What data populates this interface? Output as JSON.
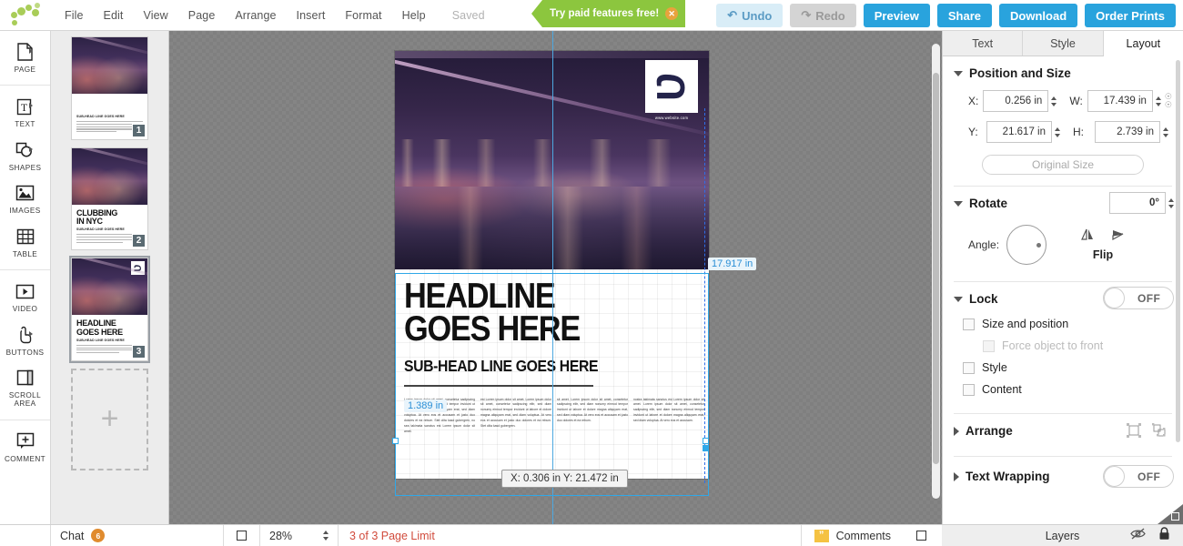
{
  "app": {
    "menu": [
      "File",
      "Edit",
      "View",
      "Page",
      "Arrange",
      "Insert",
      "Format",
      "Help"
    ],
    "saved_label": "Saved"
  },
  "promo": {
    "text": "Try paid features free!",
    "close": "✕"
  },
  "toolbar": {
    "undo": "Undo",
    "undo_icon": "↶",
    "redo": "Redo",
    "redo_icon": "↷",
    "preview": "Preview",
    "share": "Share",
    "download": "Download",
    "order_prints": "Order Prints",
    "accent": "#29a3dd"
  },
  "rail": {
    "groups": [
      {
        "items": [
          {
            "label": "PAGE",
            "icon": "page-icon",
            "arrow": true
          }
        ]
      },
      {
        "items": [
          {
            "label": "TEXT",
            "icon": "text-icon",
            "arrow": true
          },
          {
            "label": "SHAPES",
            "icon": "shapes-icon",
            "arrow": true
          },
          {
            "label": "IMAGES",
            "icon": "images-icon",
            "arrow": false
          },
          {
            "label": "TABLE",
            "icon": "table-icon",
            "arrow": false
          }
        ]
      },
      {
        "items": [
          {
            "label": "VIDEO",
            "icon": "video-icon",
            "arrow": false
          },
          {
            "label": "BUTTONS",
            "icon": "buttons-icon",
            "arrow": true
          },
          {
            "label": "SCROLL AREA",
            "icon": "scroll-area-icon",
            "arrow": false
          }
        ]
      },
      {
        "items": [
          {
            "label": "COMMENT",
            "icon": "comment-icon",
            "arrow": false
          }
        ]
      }
    ]
  },
  "pages": {
    "thumbnails": [
      {
        "number": "1",
        "headline": "",
        "subhead": "SUB-HEAD LINE GOES HERE",
        "has_logo": false
      },
      {
        "number": "2",
        "headline": "CLUBBING\nIN NYC",
        "subhead": "SUB-HEAD LINE GOES HERE",
        "has_logo": false
      },
      {
        "number": "3",
        "headline": "HEADLINE\nGOES HERE",
        "subhead": "SUB-HEAD LINE GOES HERE",
        "has_logo": true
      }
    ],
    "add_label": "+"
  },
  "document": {
    "headline_line1": "HEADLINE",
    "headline_line2": "GOES HERE",
    "subhead": "SUB-HEAD LINE GOES HERE",
    "logo_letter": "Ʋ",
    "logo_url": "www.website.com",
    "body_columns": [
      "Lorem ipsum dolor sit amet, consetetur sadipscing elitr, sed diam nonumy eirmod tempor invidunt ut labore et dolore magna aliquyam erat, sed diam voluptua. At vero eos et accusam et justo duo dolores et ea rebum. Stet clita kasd gubergren, no sea takimata sanctus est Lorem ipsum dolor sit amet.",
      "est Lorem ipsum dolor sit amet. Lorem ipsum dolor sit amet, consetetur sadipscing elitr, sed diam nonumy eirmod tempor invidunt ut labore et dolore magna aliquyam erat, sed diam voluptua. At vero eos et accusam et justo duo dolores et ea rebum. Stet clita kasd gubergren.",
      "sit amet. Lorem ipsum dolor sit amet, consetetur sadipscing elitr, sed diam nonumy eirmod tempor invidunt ut labore et dolore magna aliquyam erat, sed diam voluptua. At vero eos et accusam et justo duo dolores et ea rebum.",
      "nostra takimata sanctus est Lorem ipsum dolor sit amet. Lorem ipsum dolor sit amet, consetetur sadipscing elitr, sed diam nonumy eirmod tempor invidunt ut labore et dolore magna aliquyam erat, sed diam voluptua. At vero eos et accusam."
    ]
  },
  "canvas": {
    "width_label": "17.917 in",
    "height_label": "1.389 in",
    "coord_tooltip": "X: 0.306 in   Y: 21.472 in",
    "guide_color": "#4ea8e0"
  },
  "panel": {
    "tabs": [
      {
        "label": "Text",
        "active": false
      },
      {
        "label": "Style",
        "active": false
      },
      {
        "label": "Layout",
        "active": true
      }
    ],
    "position_and_size": {
      "title": "Position and Size",
      "x_label": "X:",
      "x_value": "0.256 in",
      "y_label": "Y:",
      "y_value": "21.617 in",
      "w_label": "W:",
      "w_value": "17.439 in",
      "h_label": "H:",
      "h_value": "2.739 in",
      "original_size": "Original Size"
    },
    "rotate": {
      "title": "Rotate",
      "angle_value": "0°",
      "angle_label": "Angle:",
      "flip_label": "Flip"
    },
    "lock": {
      "title": "Lock",
      "toggle_state": "OFF",
      "items": [
        {
          "label": "Size and position",
          "checked": false,
          "disabled": false
        },
        {
          "label": "Force object to front",
          "checked": false,
          "disabled": true
        },
        {
          "label": "Style",
          "checked": false,
          "disabled": false
        },
        {
          "label": "Content",
          "checked": false,
          "disabled": false
        }
      ]
    },
    "arrange": {
      "title": "Arrange"
    },
    "text_wrapping": {
      "title": "Text Wrapping",
      "toggle_state": "OFF"
    }
  },
  "layers_bar": {
    "label": "Layers",
    "eye_icon": "⊘",
    "lock_icon": "🔒"
  },
  "bottom": {
    "chat_label": "Chat",
    "chat_badge": "6",
    "zoom_value": "28%",
    "page_limit": "3 of 3 Page Limit",
    "page_limit_color": "#d14b3c",
    "comments_label": "Comments"
  }
}
